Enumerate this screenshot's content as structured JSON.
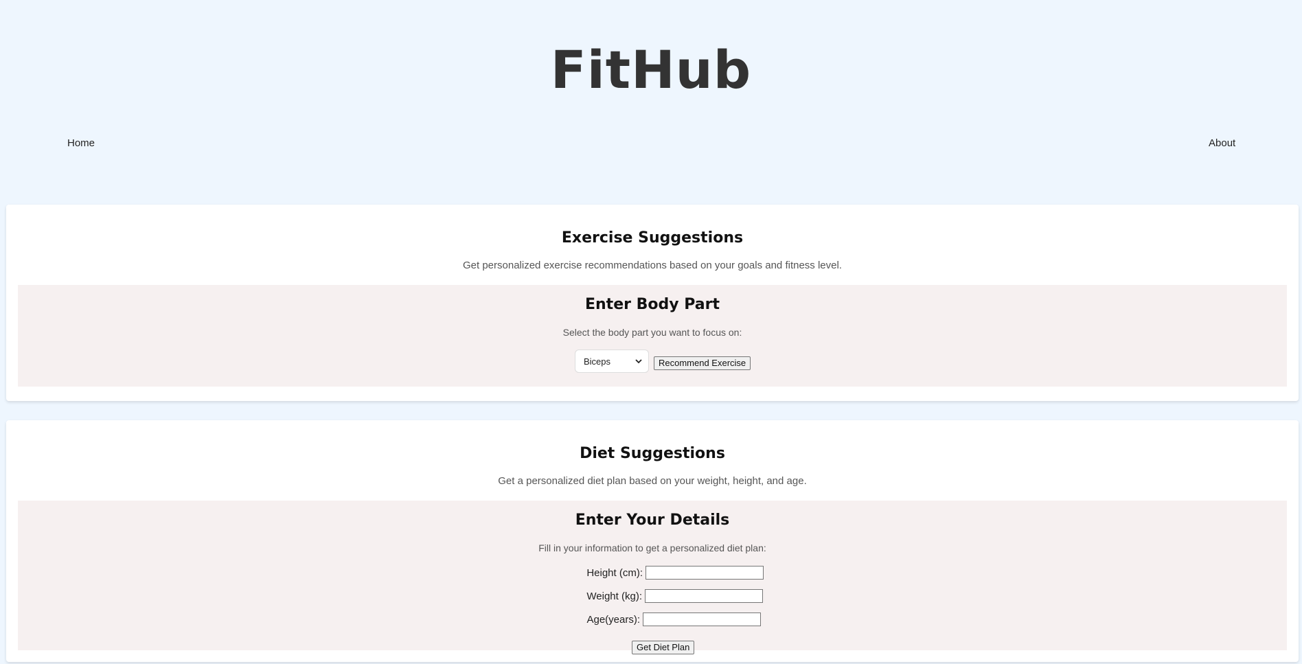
{
  "header": {
    "brand": "FitHub",
    "nav": {
      "home": "Home",
      "about": "About"
    }
  },
  "exercise": {
    "title": "Exercise Suggestions",
    "description": "Get personalized exercise recommendations based on your goals and fitness level.",
    "panel": {
      "title": "Enter Body Part",
      "description": "Select the body part you want to focus on:",
      "select_value": "Biceps",
      "button": "Recommend Exercise"
    }
  },
  "diet": {
    "title": "Diet Suggestions",
    "description": "Get a personalized diet plan based on your weight, height, and age.",
    "panel": {
      "title": "Enter Your Details",
      "description": "Fill in your information to get a personalized diet plan:",
      "fields": [
        {
          "label": "Height (cm):",
          "value": ""
        },
        {
          "label": "Weight (kg):",
          "value": ""
        },
        {
          "label": "Age(years):",
          "value": ""
        }
      ],
      "button": "Get Diet Plan"
    }
  },
  "icons": {
    "dropdown": "chevron-down-icon"
  }
}
